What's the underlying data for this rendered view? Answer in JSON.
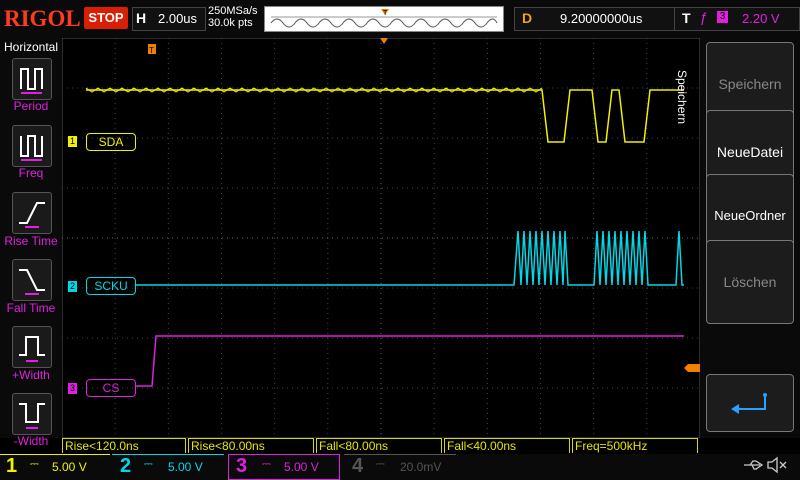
{
  "topbar": {
    "logo": "RIGOL",
    "run_status": "STOP",
    "horizontal_label": "H",
    "timebase": "2.00us",
    "sample_rate": "250MSa/s",
    "points": "30.0k pts",
    "delay_label": "D",
    "delay_value": "9.20000000us",
    "trigger_label": "T",
    "trigger_source": "3",
    "trigger_level": "2.20 V"
  },
  "left_menu": {
    "title": "Horizontal",
    "items": [
      {
        "label": "Period",
        "icon": "period-icon"
      },
      {
        "label": "Freq",
        "icon": "frequency-icon"
      },
      {
        "label": "Rise Time",
        "icon": "rise-time-icon"
      },
      {
        "label": "Fall Time",
        "icon": "fall-time-icon"
      },
      {
        "label": "+Width",
        "icon": "positive-width-icon"
      },
      {
        "label": "-Width",
        "icon": "negative-width-icon"
      }
    ]
  },
  "channels_display": {
    "ch1_label": "SDA",
    "ch1_num": "1",
    "ch2_label": "SCKU",
    "ch2_num": "2",
    "ch3_label": "CS",
    "ch3_num": "3"
  },
  "right_menu": {
    "title": "Speichern",
    "buttons": [
      {
        "label": "Speichern",
        "enabled": false
      },
      {
        "label": "NeueDatei",
        "enabled": true
      },
      {
        "label": "NeueOrdner",
        "enabled": true
      },
      {
        "label": "Löschen",
        "enabled": false
      }
    ],
    "back_icon": "return-arrow-icon"
  },
  "measurements": [
    "Rise<120.0ns",
    "Rise<80.00ns",
    "Fall<80.00ns",
    "Fall<40.00ns",
    "Freq=500kHz"
  ],
  "channel_bar": [
    {
      "num": "1",
      "value": "5.00 V"
    },
    {
      "num": "2",
      "value": "5.00 V"
    },
    {
      "num": "3",
      "value": "5.00 V"
    },
    {
      "num": "4",
      "value": "20.0mV"
    }
  ],
  "colors": {
    "ch1": "#f0f000",
    "ch2": "#00d8e8",
    "ch3": "#e020e0",
    "ch4": "#555555",
    "accent": "#f08000"
  },
  "status_icons": [
    "usb-icon",
    "speaker-muted-icon"
  ]
}
